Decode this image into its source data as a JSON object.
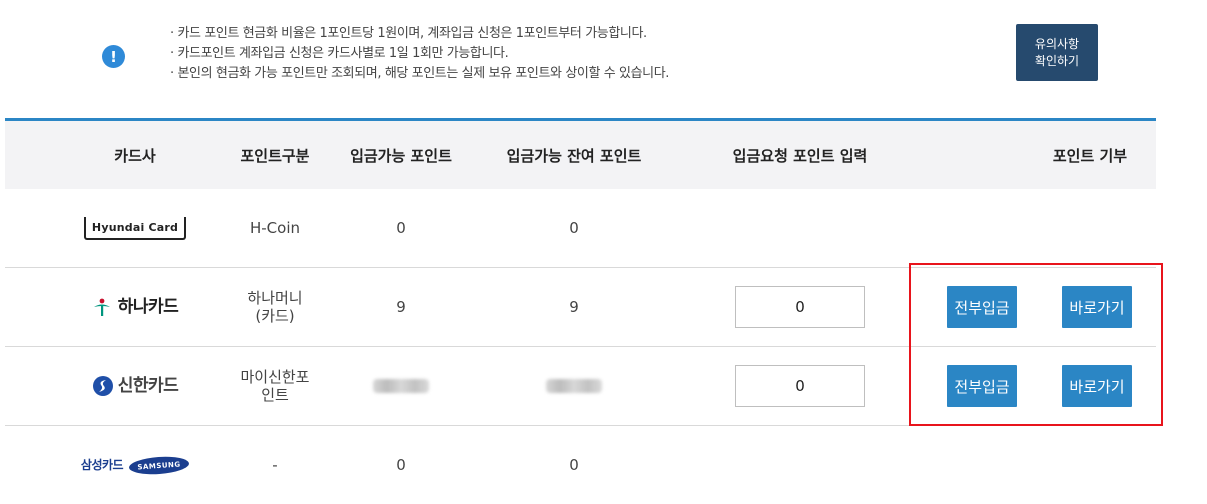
{
  "notice": {
    "icon": "exclamation-circle-icon",
    "lines": [
      "카드 포인트 현금화 비율은 1포인트당 1원이며, 계좌입금 신청은 1포인트부터 가능합니다.",
      "카드포인트 계좌입금 신청은 카드사별로 1일 1회만 가능합니다.",
      "본인의 현금화 가능 포인트만 조회되며, 해당 포인트는 실제 보유 포인트와 상이할 수 있습니다."
    ],
    "button_line1": "유의사항",
    "button_line2": "확인하기"
  },
  "table": {
    "headers": [
      "카드사",
      "포인트구분",
      "입금가능 포인트",
      "입금가능 잔여 포인트",
      "입금요청 포인트 입력",
      "포인트 기부"
    ],
    "rows": [
      {
        "card": "Hyundai Card",
        "point_type": "H-Coin",
        "available": "0",
        "remaining": "0"
      },
      {
        "card": "하나카드",
        "point_type_line1": "하나머니",
        "point_type_line2": "(카드)",
        "available": "9",
        "remaining": "9",
        "input_value": "0",
        "deposit_all": "전부입금",
        "go": "바로가기"
      },
      {
        "card": "신한카드",
        "point_type_line1": "마이신한포",
        "point_type_line2": "인트",
        "input_value": "0",
        "deposit_all": "전부입금",
        "go": "바로가기"
      },
      {
        "card": "삼성카드",
        "card_badge": "SAMSUNG",
        "point_type": "-",
        "available": "0",
        "remaining": "0"
      }
    ]
  },
  "colors": {
    "accent": "#2b86c5",
    "dark_button": "#264a6e",
    "highlight": "#e8141c"
  }
}
